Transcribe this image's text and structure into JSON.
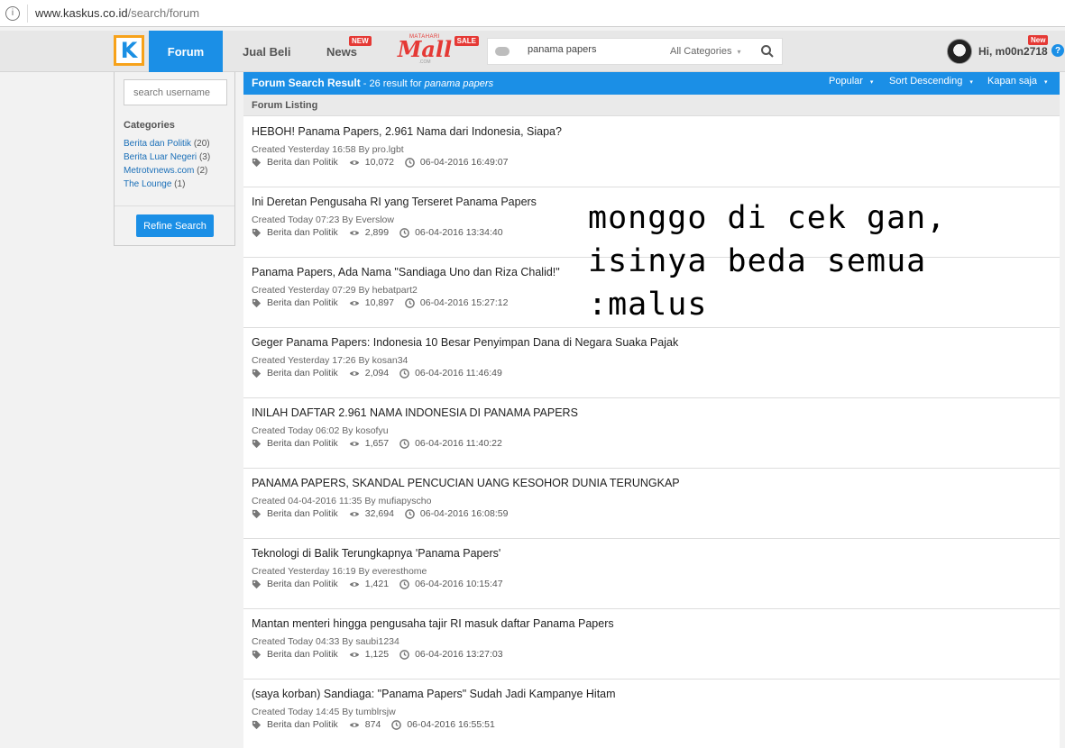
{
  "browser": {
    "url_host": "www.kaskus.co.id",
    "url_path": "/search/forum"
  },
  "nav": {
    "logo": "K",
    "forum": "Forum",
    "jual_beli": "Jual Beli",
    "news": "News",
    "news_badge": "NEW",
    "mall_top": "MATAHARI",
    "mall_word": "Mall",
    "mall_sub": ".COM",
    "mall_badge": "SALE",
    "search_value": "panama papers",
    "category": "All Categories",
    "username": "Hi, m00n2718",
    "user_badge": "New",
    "help": "?"
  },
  "sidebar": {
    "username_placeholder": "search username",
    "categories_title": "Categories",
    "categories": [
      {
        "name": "Berita dan Politik",
        "count": "(20)"
      },
      {
        "name": "Berita Luar Negeri",
        "count": "(3)"
      },
      {
        "name": "Metrotvnews.com",
        "count": "(2)"
      },
      {
        "name": "The Lounge",
        "count": "(1)"
      }
    ],
    "refine_label": "Refine Search"
  },
  "results": {
    "title": "Forum Search Result",
    "meta_prefix": " - 26 result for ",
    "query": "panama papers",
    "sort": [
      "Popular",
      "Sort Descending",
      "Kapan saja"
    ],
    "listing_label": "Forum Listing"
  },
  "threads": [
    {
      "title": "HEBOH! Panama Papers, 2.961 Nama dari Indonesia, Siapa?",
      "created": "Created Yesterday 16:58 By pro.lgbt",
      "category": "Berita dan Politik",
      "views": "10,072",
      "time": "06-04-2016 16:49:07"
    },
    {
      "title": "Ini Deretan Pengusaha RI yang Terseret Panama Papers",
      "created": "Created Today 07:23 By Everslow",
      "category": "Berita dan Politik",
      "views": "2,899",
      "time": "06-04-2016 13:34:40"
    },
    {
      "title": "Panama Papers, Ada Nama \"Sandiaga Uno dan Riza Chalid!\"",
      "created": "Created Yesterday 07:29 By hebatpart2",
      "category": "Berita dan Politik",
      "views": "10,897",
      "time": "06-04-2016 15:27:12"
    },
    {
      "title": "Geger Panama Papers: Indonesia 10 Besar Penyimpan Dana di Negara Suaka Pajak",
      "created": "Created Yesterday 17:26 By kosan34",
      "category": "Berita dan Politik",
      "views": "2,094",
      "time": "06-04-2016 11:46:49"
    },
    {
      "title": "INILAH DAFTAR 2.961 NAMA INDONESIA DI PANAMA PAPERS",
      "created": "Created Today 06:02 By kosofyu",
      "category": "Berita dan Politik",
      "views": "1,657",
      "time": "06-04-2016 11:40:22"
    },
    {
      "title": "PANAMA PAPERS, SKANDAL PENCUCIAN UANG KESOHOR DUNIA TERUNGKAP",
      "created": "Created 04-04-2016 11:35 By mufiapyscho",
      "category": "Berita dan Politik",
      "views": "32,694",
      "time": "06-04-2016 16:08:59"
    },
    {
      "title": "Teknologi di Balik Terungkapnya 'Panama Papers'",
      "created": "Created Yesterday 16:19 By everesthome",
      "category": "Berita dan Politik",
      "views": "1,421",
      "time": "06-04-2016 10:15:47"
    },
    {
      "title": "Mantan menteri hingga pengusaha tajir RI masuk daftar Panama Papers",
      "created": "Created Today 04:33 By saubi1234",
      "category": "Berita dan Politik",
      "views": "1,125",
      "time": "06-04-2016 13:27:03"
    },
    {
      "title": "(saya korban) Sandiaga: \"Panama Papers\" Sudah Jadi Kampanye Hitam",
      "created": "Created Today 14:45 By tumblrsjw",
      "category": "Berita dan Politik",
      "views": "874",
      "time": "06-04-2016 16:55:51"
    }
  ],
  "overlay": {
    "line1": "monggo di cek gan,",
    "line2": "isinya beda semua",
    "line3": ":malus"
  }
}
